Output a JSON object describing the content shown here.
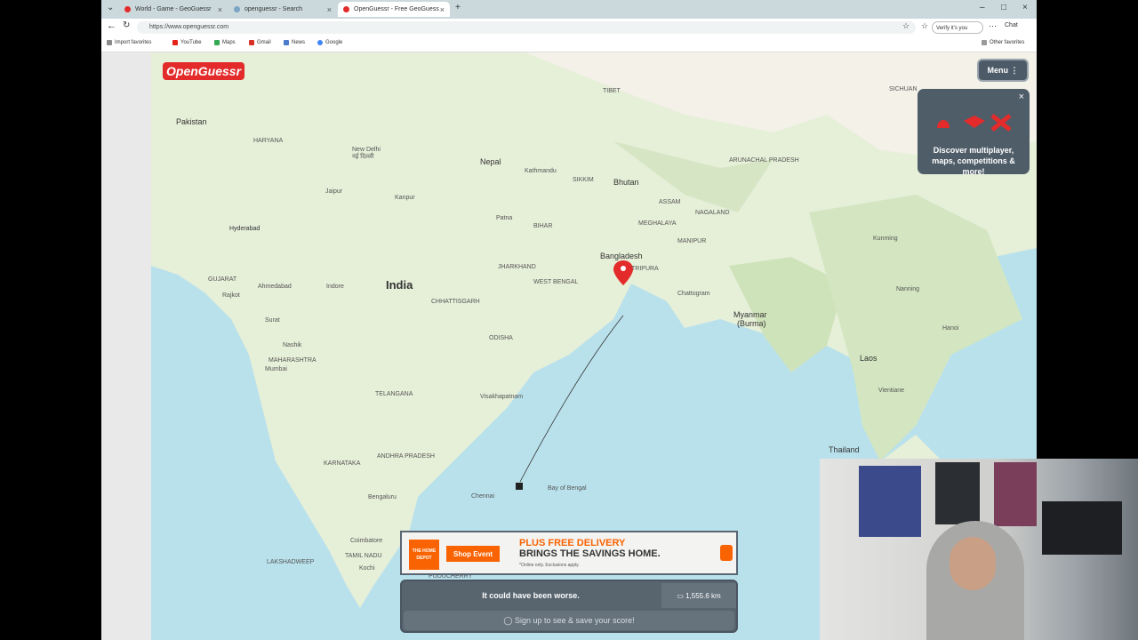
{
  "tabs": [
    {
      "label": "World - Game - GeoGuessr",
      "active": false
    },
    {
      "label": "openguessr - Search",
      "active": false
    },
    {
      "label": "OpenGuessr - Free GeoGuess",
      "active": true
    }
  ],
  "address": {
    "url": "https://www.openguessr.com",
    "verify_label": "Verify it's you",
    "chat_label": "Chat"
  },
  "favorites": [
    "Import favorites",
    "YouTube",
    "Maps",
    "Gmail",
    "News",
    "Google"
  ],
  "other_favorites": "Other favorites",
  "map": {
    "labels": [
      {
        "text": "Pakistan",
        "cls": "country"
      },
      {
        "text": "India",
        "cls": "country big"
      },
      {
        "text": "Nepal",
        "cls": "country"
      },
      {
        "text": "Bhutan",
        "cls": "country"
      },
      {
        "text": "Bangladesh",
        "cls": "country"
      },
      {
        "text": "Myanmar",
        "cls": "country"
      },
      {
        "text": "(Burma)",
        "cls": "country"
      },
      {
        "text": "Laos",
        "cls": "country"
      },
      {
        "text": "Thailand",
        "cls": "country"
      },
      {
        "text": "TIBET",
        "cls": "maplabel"
      },
      {
        "text": "SICHUAN",
        "cls": "maplabel"
      },
      {
        "text": "HARYANA",
        "cls": "maplabel"
      },
      {
        "text": "New Delhi",
        "cls": "maplabel"
      },
      {
        "text": "नई दिल्ली",
        "cls": "maplabel"
      },
      {
        "text": "Jaipur",
        "cls": "maplabel"
      },
      {
        "text": "Kanpur",
        "cls": "maplabel"
      },
      {
        "text": "Patna",
        "cls": "maplabel"
      },
      {
        "text": "BIHAR",
        "cls": "maplabel"
      },
      {
        "text": "Kathmandu",
        "cls": "maplabel"
      },
      {
        "text": "SIKKIM",
        "cls": "maplabel"
      },
      {
        "text": "ASSAM",
        "cls": "maplabel"
      },
      {
        "text": "MEGHALAYA",
        "cls": "maplabel"
      },
      {
        "text": "NAGALAND",
        "cls": "maplabel"
      },
      {
        "text": "MANIPUR",
        "cls": "maplabel"
      },
      {
        "text": "TRIPURA",
        "cls": "maplabel"
      },
      {
        "text": "Chattogram",
        "cls": "maplabel"
      },
      {
        "text": "ARUNACHAL PRADESH",
        "cls": "maplabel"
      },
      {
        "text": "JHARKHAND",
        "cls": "maplabel"
      },
      {
        "text": "WEST BENGAL",
        "cls": "maplabel"
      },
      {
        "text": "CHHATTISGARH",
        "cls": "maplabel"
      },
      {
        "text": "ODISHA",
        "cls": "maplabel"
      },
      {
        "text": "GUJARAT",
        "cls": "maplabel"
      },
      {
        "text": "Ahmedabad",
        "cls": "maplabel"
      },
      {
        "text": "Rajkot",
        "cls": "maplabel"
      },
      {
        "text": "Indore",
        "cls": "maplabel"
      },
      {
        "text": "Surat",
        "cls": "maplabel"
      },
      {
        "text": "Nashik",
        "cls": "maplabel"
      },
      {
        "text": "Mumbai",
        "cls": "maplabel"
      },
      {
        "text": "MAHARASHTRA",
        "cls": "maplabel"
      },
      {
        "text": "TELANGANA",
        "cls": "maplabel"
      },
      {
        "text": "Hyderabad",
        "cls": "maplabel"
      },
      {
        "text": "Visakhapatnam",
        "cls": "maplabel"
      },
      {
        "text": "KARNATAKA",
        "cls": "maplabel"
      },
      {
        "text": "ANDHRA PRADESH",
        "cls": "maplabel"
      },
      {
        "text": "Bengaluru",
        "cls": "maplabel"
      },
      {
        "text": "Chennai",
        "cls": "maplabel"
      },
      {
        "text": "Coimbatore",
        "cls": "maplabel"
      },
      {
        "text": "TAMIL NADU",
        "cls": "maplabel"
      },
      {
        "text": "Kochi",
        "cls": "maplabel"
      },
      {
        "text": "LAKSHADWEEP",
        "cls": "maplabel"
      },
      {
        "text": "PUDUCHERRY",
        "cls": "maplabel"
      },
      {
        "text": "Kunming",
        "cls": "maplabel"
      },
      {
        "text": "Nanning",
        "cls": "maplabel"
      },
      {
        "text": "Hanoi",
        "cls": "maplabel"
      },
      {
        "text": "Vientiane",
        "cls": "maplabel"
      },
      {
        "text": "Bay of Bengal",
        "cls": "maplabel"
      },
      {
        "text": "Hyderabad",
        "cls": "maplabel"
      }
    ]
  },
  "logo": "OpenGuessr",
  "menu_label": "Menu",
  "promo": {
    "text": "Discover multiplayer, maps, competitions & more!"
  },
  "ad": {
    "brand": "THE HOME DEPOT",
    "button": "Shop Event",
    "headline1": "PLUS FREE DELIVERY",
    "headline2": "BRINGS THE SAVINGS HOME.",
    "fine": "*Online only. Exclusions apply."
  },
  "result": {
    "message": "It could have been worse.",
    "distance": "1,555.6 km",
    "signup": "Sign up to see & save your score!"
  },
  "colors": {
    "brand_red": "#e32b2b",
    "panel": "#58656f",
    "home_depot": "#f96302"
  }
}
